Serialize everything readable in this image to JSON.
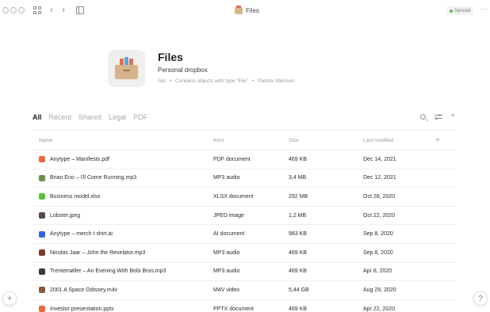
{
  "window": {
    "breadcrumb_title": "Files",
    "sync_status": "Synced",
    "more_label": "···",
    "icons": [
      "traffic-lights",
      "grid-icon",
      "back-icon",
      "forward-icon",
      "sidebar-icon"
    ]
  },
  "header": {
    "title": "Files",
    "description": "Personal dropbox",
    "meta": [
      "Set",
      "•",
      "Contains objects with type “File”",
      "•",
      "Patrick Atkinson"
    ]
  },
  "tabs": [
    {
      "label": "All",
      "active": true
    },
    {
      "label": "Recent",
      "active": false
    },
    {
      "label": "Shared",
      "active": false
    },
    {
      "label": "Legal",
      "active": false
    },
    {
      "label": "PDF",
      "active": false
    }
  ],
  "table": {
    "columns": {
      "name": "Name",
      "kind": "Kind",
      "size": "Size",
      "modified": "Last modified"
    },
    "rows": [
      {
        "name": "Anytype – Manifesto.pdf",
        "kind": "PDF document",
        "size": "469 KB",
        "modified": "Dec 14, 2021",
        "icon_color": "#e8693e"
      },
      {
        "name": "Brian Eno – I'll Come Running.mp3",
        "kind": "MP3 audio",
        "size": "3,4 MB",
        "modified": "Dec 12, 2021",
        "icon_color": "#6f8f4f"
      },
      {
        "name": "Business model.xlsx",
        "kind": "XLSX document",
        "size": "292 MB",
        "modified": "Oct 28, 2020",
        "icon_color": "#5bbf3a"
      },
      {
        "name": "Lobster.jpeg",
        "kind": "JPED image",
        "size": "1,2 MB",
        "modified": "Oct 22, 2020",
        "icon_color": "#5a4a44"
      },
      {
        "name": "Anytype – merch t shirt.ai",
        "kind": "AI document",
        "size": "983 KB",
        "modified": "Sep 8, 2020",
        "icon_color": "#3b63d8"
      },
      {
        "name": "Nicolas Jaar – John the Revelator.mp3",
        "kind": "MP3 audio",
        "size": "469 KB",
        "modified": "Sep 8, 2020",
        "icon_color": "#7a3b2a"
      },
      {
        "name": "Trentemøller – An Evening With Bobi Bros.mp3",
        "kind": "MP3 audio",
        "size": "469 KB",
        "modified": "Apr 8, 2020",
        "icon_color": "#3a3a3a"
      },
      {
        "name": "2001 A Space Odissey.m4v",
        "kind": "M4V video",
        "size": "5,44 GB",
        "modified": "Aug 29, 2020",
        "icon_color": "#8a5a3a"
      },
      {
        "name": "Investor presentation.pptx",
        "kind": "PPTX document",
        "size": "469 KB",
        "modified": "Apr 22, 2020",
        "icon_color": "#e8693e"
      }
    ]
  },
  "floating": {
    "add_label": "+",
    "help_label": "?"
  }
}
